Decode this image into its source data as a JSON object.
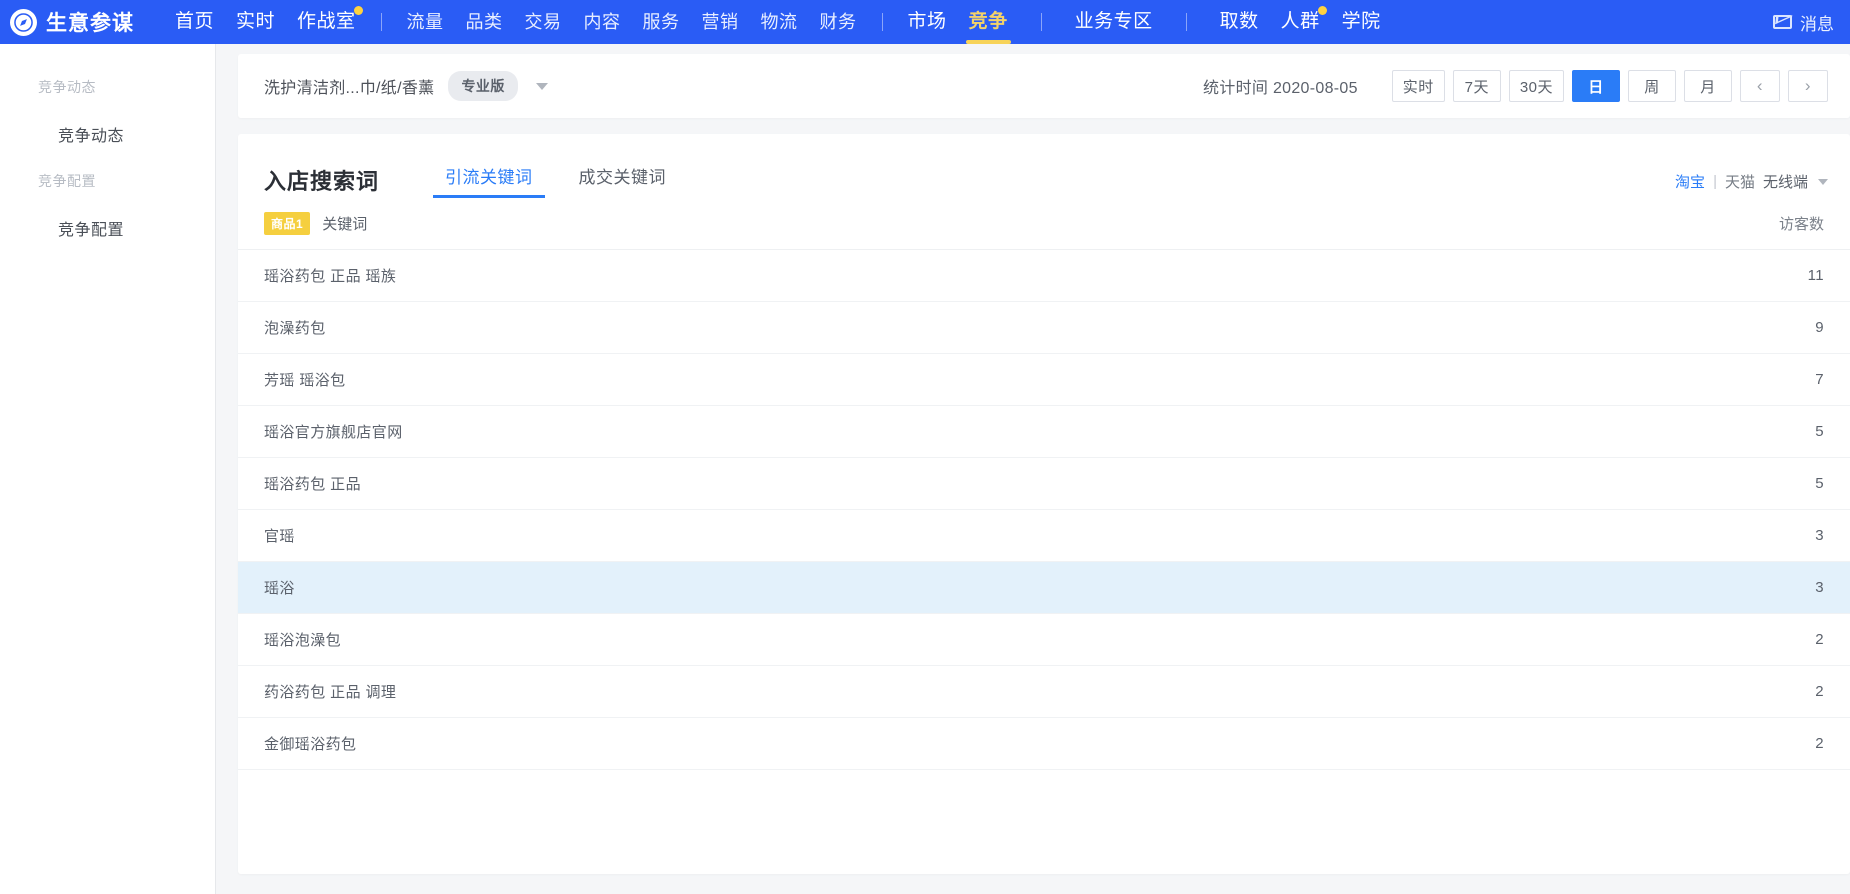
{
  "topnav": {
    "brand": "生意参谋",
    "logo_icon": "compass-icon",
    "primary_items": [
      {
        "label": "首页",
        "active": false,
        "dot": false
      },
      {
        "label": "实时",
        "active": false,
        "dot": false
      },
      {
        "label": "作战室",
        "active": false,
        "dot": true
      }
    ],
    "module_items": [
      {
        "label": "流量",
        "active": false,
        "dot": false
      },
      {
        "label": "品类",
        "active": false,
        "dot": false
      },
      {
        "label": "交易",
        "active": false,
        "dot": false
      },
      {
        "label": "内容",
        "active": false,
        "dot": false
      },
      {
        "label": "服务",
        "active": false,
        "dot": false
      },
      {
        "label": "营销",
        "active": false,
        "dot": false
      },
      {
        "label": "物流",
        "active": false,
        "dot": false
      },
      {
        "label": "财务",
        "active": false,
        "dot": false
      }
    ],
    "market_items": [
      {
        "label": "市场",
        "active": false,
        "dot": false
      },
      {
        "label": "竞争",
        "active": true,
        "dot": false
      }
    ],
    "zone_items": [
      {
        "label": "业务专区",
        "active": false,
        "dot": false
      }
    ],
    "tool_items": [
      {
        "label": "取数",
        "active": false,
        "dot": false
      },
      {
        "label": "人群",
        "active": false,
        "dot": true
      },
      {
        "label": "学院",
        "active": false,
        "dot": false
      }
    ],
    "message_label": "消息",
    "message_icon": "mail-icon"
  },
  "sidebar": {
    "sections": [
      {
        "group": "竞争动态",
        "items": [
          "竞争动态"
        ]
      },
      {
        "group": "竞争配置",
        "items": [
          "竞争配置"
        ]
      }
    ]
  },
  "filterbar": {
    "category": "洗护清洁剂...巾/纸/香薰",
    "version_badge": "专业版",
    "category_caret_icon": "chevron-down-icon",
    "stat_time": "统计时间 2020-08-05",
    "range_buttons": [
      {
        "label": "实时",
        "active": false
      },
      {
        "label": "7天",
        "active": false
      },
      {
        "label": "30天",
        "active": false
      }
    ],
    "granularity_buttons": [
      {
        "label": "日",
        "active": true
      },
      {
        "label": "周",
        "active": false
      },
      {
        "label": "月",
        "active": false
      }
    ],
    "prev_icon": "chevron-left-icon",
    "prev_label": "‹",
    "next_icon": "chevron-right-icon",
    "next_label": "›"
  },
  "card": {
    "title": "入店搜索词",
    "tabs": [
      {
        "label": "引流关键词",
        "active": true
      },
      {
        "label": "成交关键词",
        "active": false
      }
    ],
    "channel": {
      "taobao": "淘宝",
      "divider": "|",
      "tmall": "天猫",
      "terminal": "无线端",
      "caret_icon": "chevron-down-icon"
    },
    "table": {
      "goods_badge": "商品1",
      "col_keyword": "关键词",
      "col_visitors": "访客数",
      "rows": [
        {
          "keyword": "瑶浴药包 正品 瑶族",
          "visitors": "11",
          "highlight": false
        },
        {
          "keyword": "泡澡药包",
          "visitors": "9",
          "highlight": false
        },
        {
          "keyword": "芳瑶 瑶浴包",
          "visitors": "7",
          "highlight": false
        },
        {
          "keyword": "瑶浴官方旗舰店官网",
          "visitors": "5",
          "highlight": false
        },
        {
          "keyword": "瑶浴药包 正品",
          "visitors": "5",
          "highlight": false
        },
        {
          "keyword": "官瑶",
          "visitors": "3",
          "highlight": false
        },
        {
          "keyword": "瑶浴",
          "visitors": "3",
          "highlight": true
        },
        {
          "keyword": "瑶浴泡澡包",
          "visitors": "2",
          "highlight": false
        },
        {
          "keyword": "药浴药包 正品 调理",
          "visitors": "2",
          "highlight": false
        },
        {
          "keyword": "金御瑶浴药包",
          "visitors": "2",
          "highlight": false
        }
      ]
    }
  }
}
